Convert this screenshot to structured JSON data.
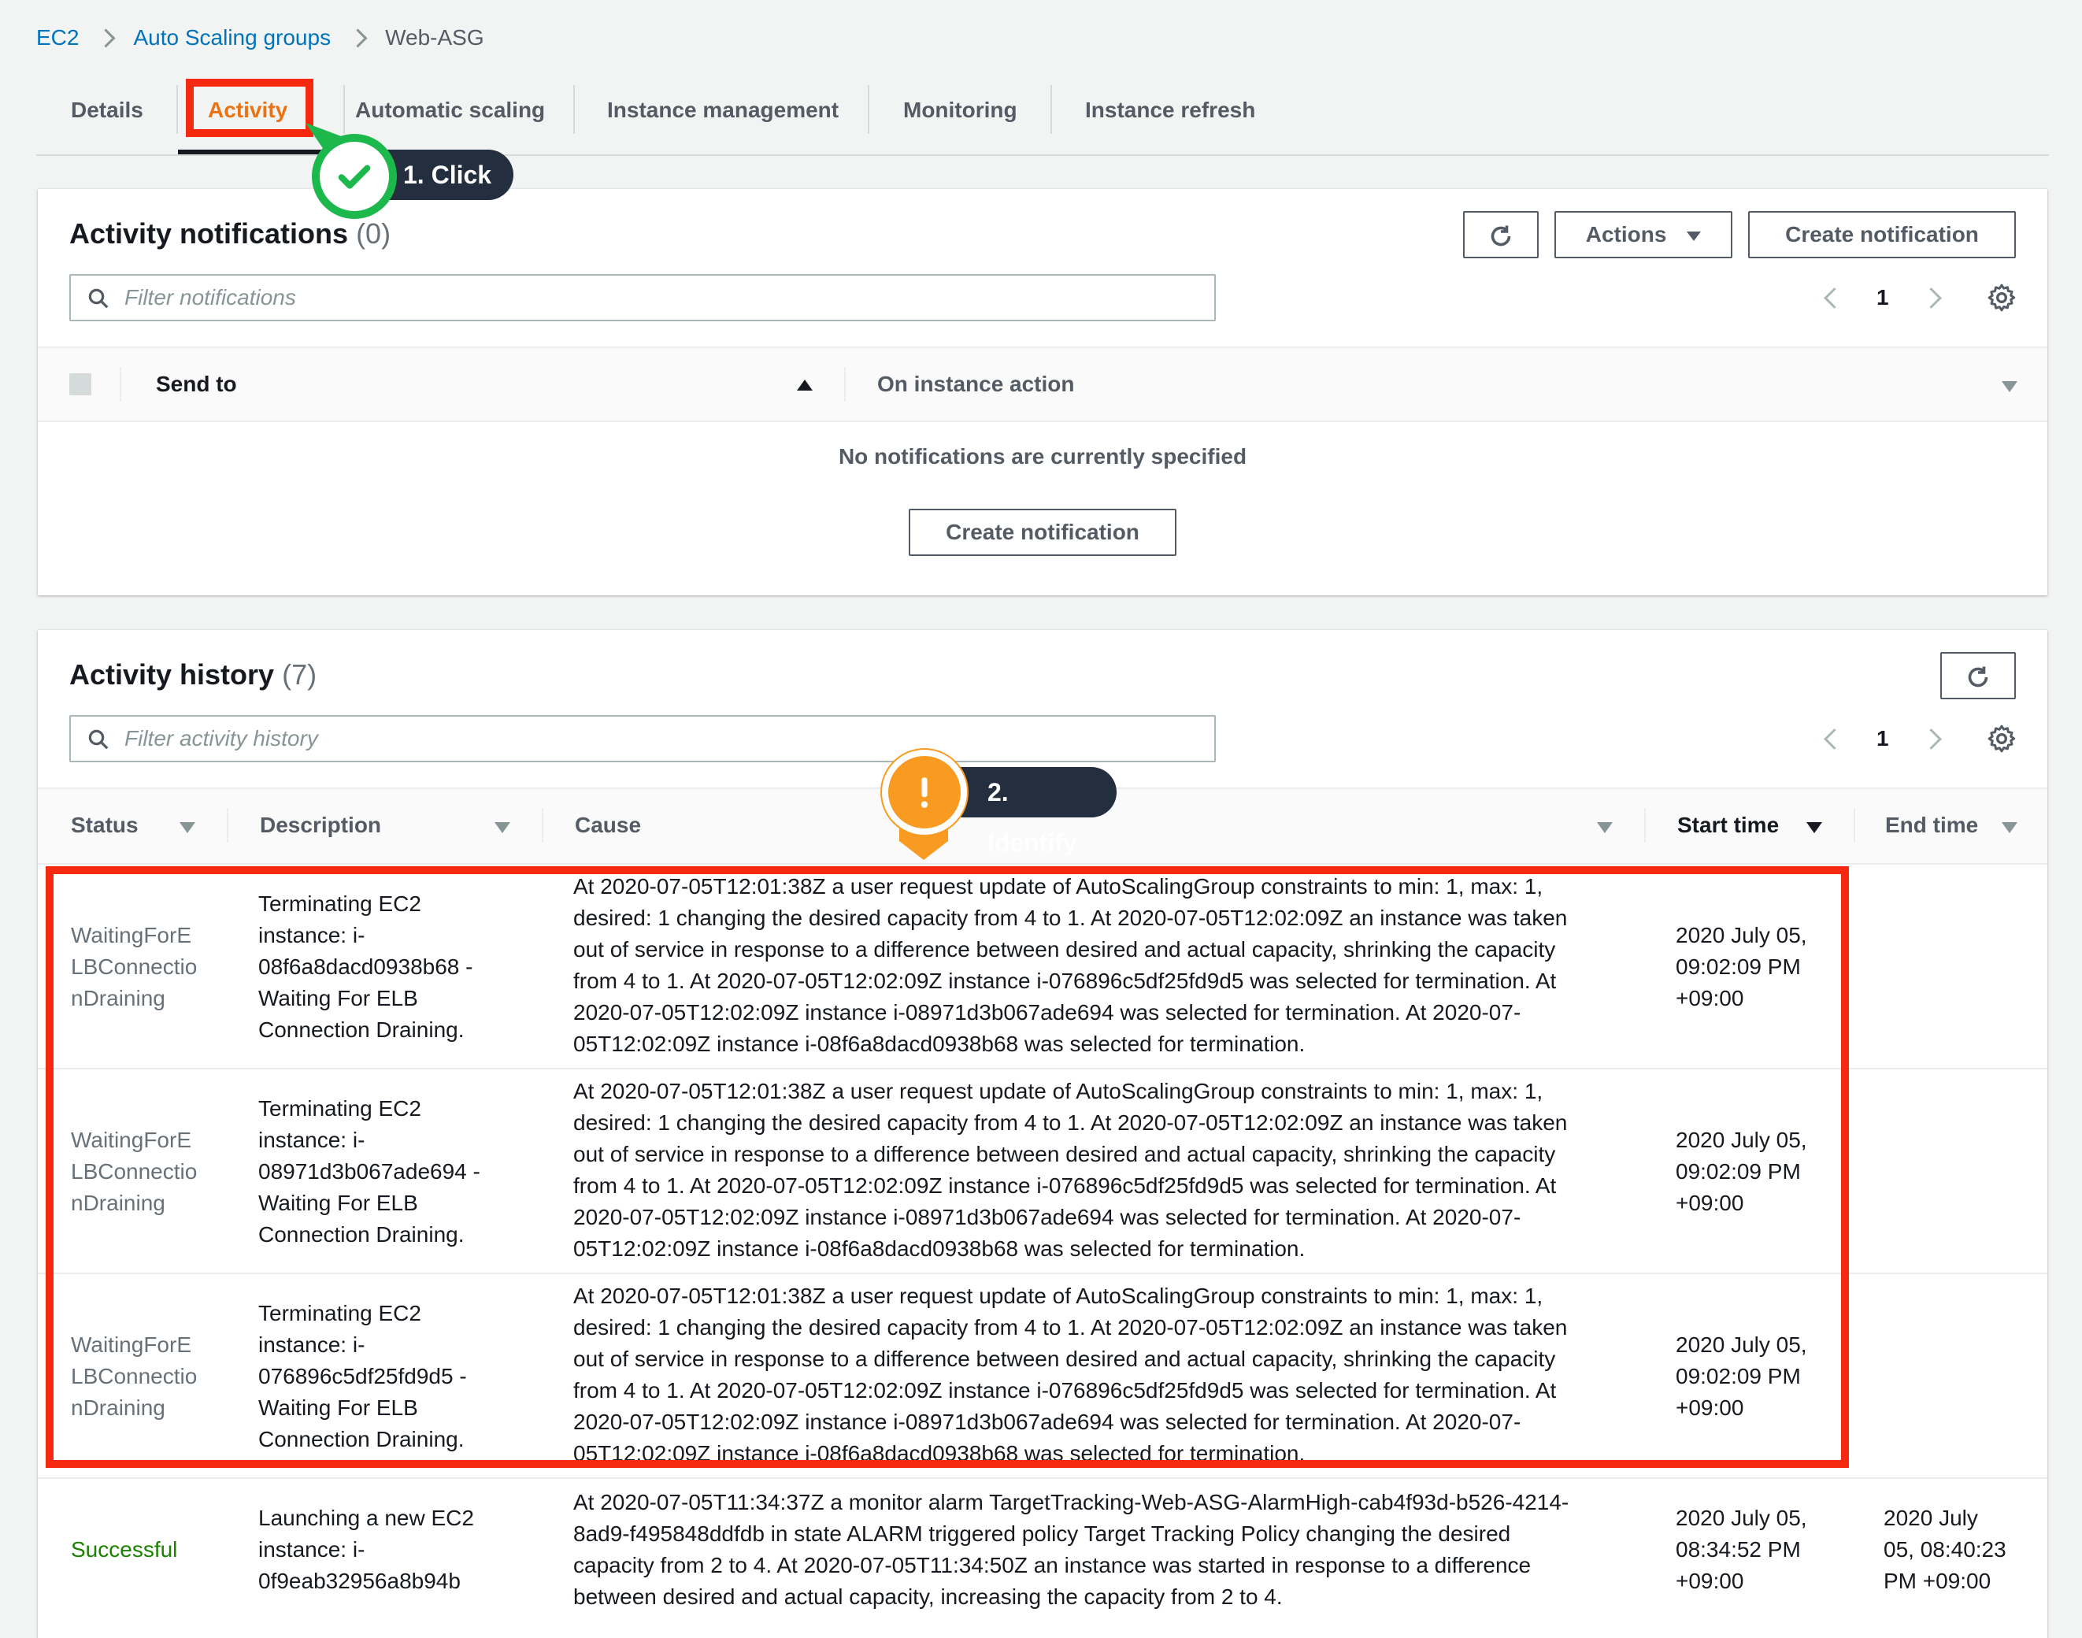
{
  "breadcrumb": {
    "items": [
      "EC2",
      "Auto Scaling groups"
    ],
    "current": "Web-ASG"
  },
  "tabs": [
    "Details",
    "Activity",
    "Automatic scaling",
    "Instance management",
    "Monitoring",
    "Instance refresh"
  ],
  "active_tab": "Activity",
  "callouts": {
    "click": "1. Click",
    "identify": "2. Identify"
  },
  "notifications": {
    "title": "Activity notifications",
    "count": "(0)",
    "actions_label": "Actions",
    "create_label": "Create notification",
    "filter_placeholder": "Filter notifications",
    "page": "1",
    "columns": [
      "Send to",
      "On instance action"
    ],
    "empty_text": "No notifications are currently specified",
    "empty_button": "Create notification"
  },
  "history": {
    "title": "Activity history",
    "count": "(7)",
    "filter_placeholder": "Filter activity history",
    "page": "1",
    "columns": [
      "Status",
      "Description",
      "Cause",
      "Start time",
      "End time"
    ],
    "rows": [
      {
        "status": [
          "WaitingForE",
          "LBConnectio",
          "nDraining"
        ],
        "description": [
          "Terminating EC2",
          "instance: i-",
          "08f6a8dacd0938b68 -",
          "Waiting For ELB",
          "Connection Draining."
        ],
        "cause": [
          "At 2020-07-05T12:01:38Z a user request update of AutoScalingGroup constraints to min: 1, max: 1,",
          "desired: 1 changing the desired capacity from 4 to 1. At 2020-07-05T12:02:09Z an instance was taken",
          "out of service in response to a difference between desired and actual capacity, shrinking the capacity",
          "from 4 to 1. At 2020-07-05T12:02:09Z instance i-076896c5df25fd9d5 was selected for termination. At",
          "2020-07-05T12:02:09Z instance i-08971d3b067ade694 was selected for termination. At 2020-07-",
          "05T12:02:09Z instance i-08f6a8dacd0938b68 was selected for termination."
        ],
        "start": [
          "2020 July 05,",
          "09:02:09 PM",
          "+09:00"
        ],
        "end": []
      },
      {
        "status": [
          "WaitingForE",
          "LBConnectio",
          "nDraining"
        ],
        "description": [
          "Terminating EC2",
          "instance: i-",
          "08971d3b067ade694 -",
          "Waiting For ELB",
          "Connection Draining."
        ],
        "cause": [
          "At 2020-07-05T12:01:38Z a user request update of AutoScalingGroup constraints to min: 1, max: 1,",
          "desired: 1 changing the desired capacity from 4 to 1. At 2020-07-05T12:02:09Z an instance was taken",
          "out of service in response to a difference between desired and actual capacity, shrinking the capacity",
          "from 4 to 1. At 2020-07-05T12:02:09Z instance i-076896c5df25fd9d5 was selected for termination. At",
          "2020-07-05T12:02:09Z instance i-08971d3b067ade694 was selected for termination. At 2020-07-",
          "05T12:02:09Z instance i-08f6a8dacd0938b68 was selected for termination."
        ],
        "start": [
          "2020 July 05,",
          "09:02:09 PM",
          "+09:00"
        ],
        "end": []
      },
      {
        "status": [
          "WaitingForE",
          "LBConnectio",
          "nDraining"
        ],
        "description": [
          "Terminating EC2",
          "instance: i-",
          "076896c5df25fd9d5 -",
          "Waiting For ELB",
          "Connection Draining."
        ],
        "cause": [
          "At 2020-07-05T12:01:38Z a user request update of AutoScalingGroup constraints to min: 1, max: 1,",
          "desired: 1 changing the desired capacity from 4 to 1. At 2020-07-05T12:02:09Z an instance was taken",
          "out of service in response to a difference between desired and actual capacity, shrinking the capacity",
          "from 4 to 1. At 2020-07-05T12:02:09Z instance i-076896c5df25fd9d5 was selected for termination. At",
          "2020-07-05T12:02:09Z instance i-08971d3b067ade694 was selected for termination. At 2020-07-",
          "05T12:02:09Z instance i-08f6a8dacd0938b68 was selected for termination."
        ],
        "start": [
          "2020 July 05,",
          "09:02:09 PM",
          "+09:00"
        ],
        "end": []
      },
      {
        "status": [
          "Successful"
        ],
        "description": [
          "Launching a new EC2",
          "instance: i-",
          "0f9eab32956a8b94b"
        ],
        "cause": [
          "At 2020-07-05T11:34:37Z a monitor alarm TargetTracking-Web-ASG-AlarmHigh-cab4f93d-b526-4214-",
          "8ad9-f495848ddfdb in state ALARM triggered policy Target Tracking Policy changing the desired",
          "capacity from 2 to 4. At 2020-07-05T11:34:50Z an instance was started in response to a difference",
          "between desired and actual capacity, increasing the capacity from 2 to 4."
        ],
        "start": [
          "2020 July 05,",
          "08:34:52 PM",
          "+09:00"
        ],
        "end": [
          "2020 July",
          "05, 08:40:23",
          "PM +09:00"
        ]
      }
    ]
  },
  "colors": {
    "link": "#0073bb",
    "active_tab": "#ec7211",
    "highlight": "#f5290f",
    "success": "#1d8102",
    "callout_green": "#1db84c",
    "callout_orange": "#f89b20"
  },
  "icons": [
    "chevron-right-icon",
    "search-icon",
    "refresh-icon",
    "caret-down-icon",
    "settings-gear-icon",
    "checkmark-icon",
    "exclamation-icon",
    "sort-ascending-icon",
    "sort-descending-icon",
    "filter-caret-icon"
  ]
}
